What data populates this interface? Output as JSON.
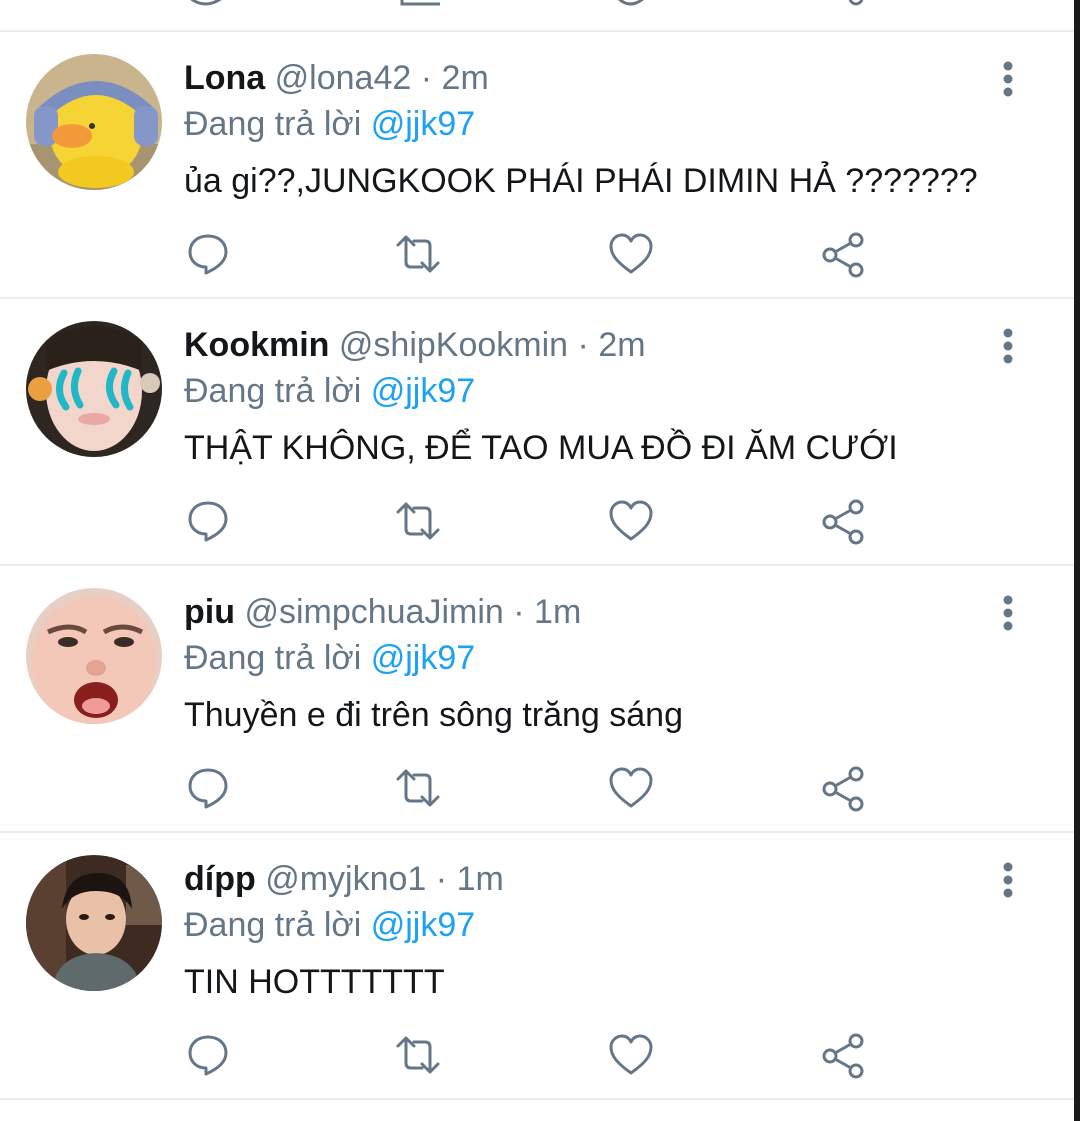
{
  "tweets": [
    {
      "name": "Lona",
      "handle": "@lona42",
      "separator": "·",
      "time": "2m",
      "reply_prefix": "Đang trả lời",
      "reply_to": "@jjk97",
      "text": "ủa gi??,JUNGKOOK PHÁI PHÁI DIMIN HẢ ???????"
    },
    {
      "name": "Kookmin",
      "handle": "@shipKookmin",
      "separator": "·",
      "time": "2m",
      "reply_prefix": "Đang trả lời",
      "reply_to": "@jjk97",
      "text": "THẬT KHÔNG, ĐỂ TAO MUA ĐỒ ĐI ĂM CƯỚI"
    },
    {
      "name": "piu",
      "handle": "@simpchuaJimin",
      "separator": "·",
      "time": "1m",
      "reply_prefix": "Đang trả lời",
      "reply_to": "@jjk97",
      "text": "Thuyền e đi trên sông trăng sáng"
    },
    {
      "name": "dípp",
      "handle": "@myjkno1",
      "separator": "·",
      "time": "1m",
      "reply_prefix": "Đang trả lời",
      "reply_to": "@jjk97",
      "text": "TIN HOTTTTTTT"
    }
  ],
  "icons": {
    "reply": "comment-bubble-icon",
    "retweet": "retweet-icon",
    "like": "heart-icon",
    "share": "share-icon",
    "more": "more-vertical-icon"
  },
  "colors": {
    "name": "#14171a",
    "secondary": "#657786",
    "mention": "#1da1f2",
    "icon": "#657786",
    "divider": "#e6ecf0"
  }
}
